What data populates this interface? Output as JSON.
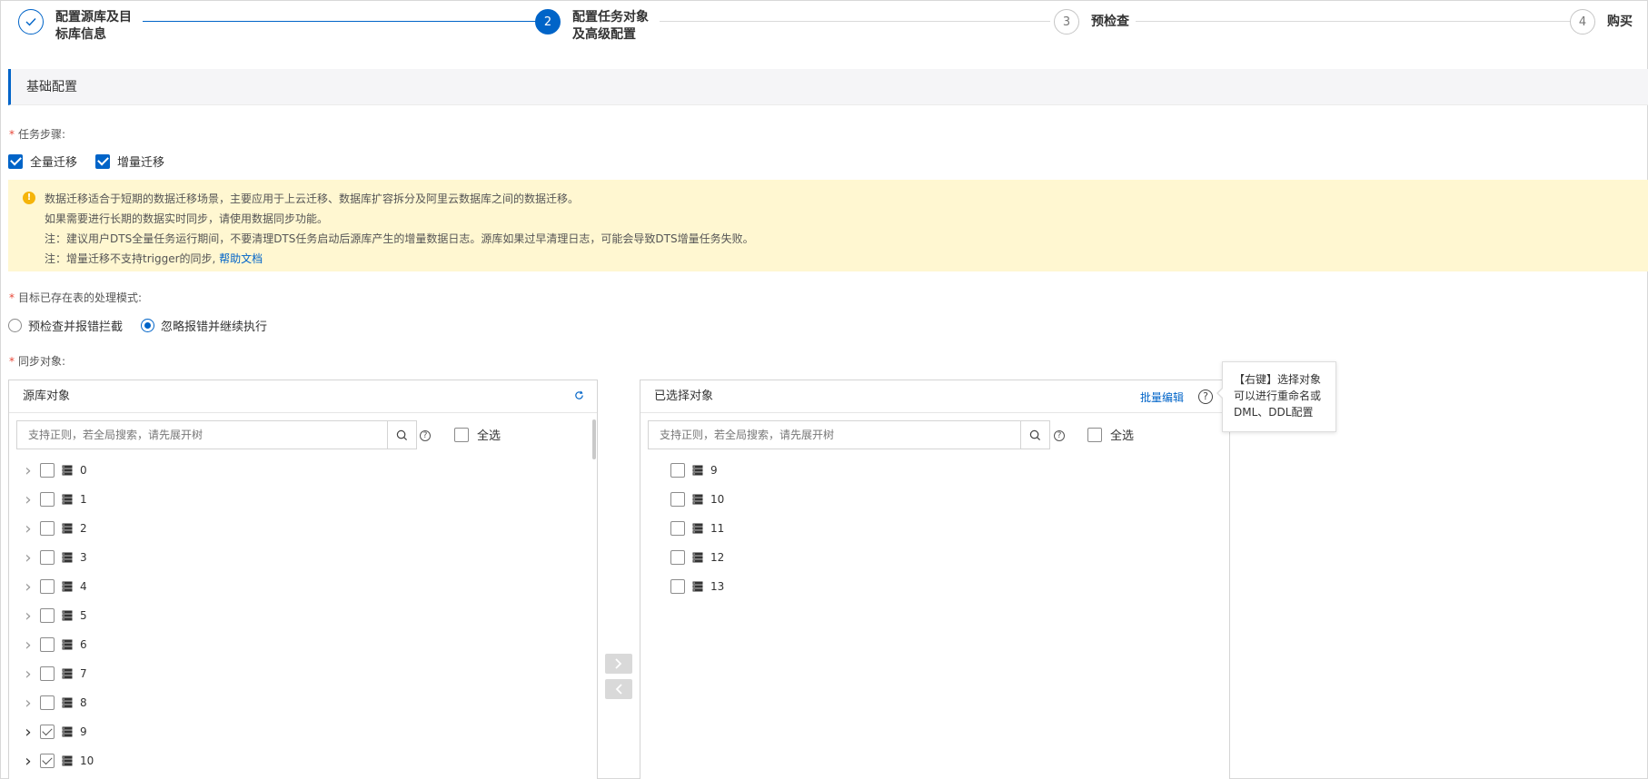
{
  "stepper": {
    "steps": [
      {
        "num": "",
        "label": "配置源库及目\n标库信息",
        "state": "done"
      },
      {
        "num": "2",
        "label": "配置任务对象\n及高级配置",
        "state": "active"
      },
      {
        "num": "3",
        "label": "预检查",
        "state": "pending"
      },
      {
        "num": "4",
        "label": "购买",
        "state": "pending"
      }
    ]
  },
  "section": {
    "title": "基础配置"
  },
  "task_steps": {
    "label": "任务步骤:",
    "options": [
      {
        "label": "全量迁移",
        "checked": true
      },
      {
        "label": "增量迁移",
        "checked": true
      }
    ]
  },
  "notice": {
    "lines": [
      "数据迁移适合于短期的数据迁移场景，主要应用于上云迁移、数据库扩容拆分及阿里云数据库之间的数据迁移。",
      "如果需要进行长期的数据实时同步，请使用数据同步功能。",
      "注：建议用户DTS全量任务运行期间，不要清理DTS任务启动后源库产生的增量数据日志。源库如果过早清理日志，可能会导致DTS增量任务失败。",
      "注：增量迁移不支持trigger的同步,"
    ],
    "link": "帮助文档"
  },
  "conflict_mode": {
    "label": "目标已存在表的处理模式:",
    "options": [
      {
        "label": "预检查并报错拦截",
        "selected": false
      },
      {
        "label": "忽略报错并继续执行",
        "selected": true
      }
    ]
  },
  "sync_objects": {
    "label": "同步对象:"
  },
  "source_panel": {
    "title": "源库对象",
    "search_placeholder": "支持正则，若全局搜索，请先展开树",
    "select_all": "全选",
    "items": [
      {
        "name": "0",
        "checked": false
      },
      {
        "name": "1",
        "checked": false
      },
      {
        "name": "2",
        "checked": false
      },
      {
        "name": "3",
        "checked": false
      },
      {
        "name": "4",
        "checked": false
      },
      {
        "name": "5",
        "checked": false
      },
      {
        "name": "6",
        "checked": false
      },
      {
        "name": "7",
        "checked": false
      },
      {
        "name": "8",
        "checked": false
      },
      {
        "name": "9",
        "checked": true
      },
      {
        "name": "10",
        "checked": true
      }
    ]
  },
  "target_panel": {
    "title": "已选择对象",
    "batch_edit": "批量编辑",
    "search_placeholder": "支持正则，若全局搜索，请先展开树",
    "select_all": "全选",
    "items": [
      {
        "name": "9"
      },
      {
        "name": "10"
      },
      {
        "name": "11"
      },
      {
        "name": "12"
      },
      {
        "name": "13"
      }
    ]
  },
  "tooltip": {
    "text": "【右键】选择对象可以进行重命名或DML、DDL配置"
  },
  "colors": {
    "primary": "#0064c8",
    "notice_bg": "#fff7d1",
    "required": "#e84738"
  }
}
